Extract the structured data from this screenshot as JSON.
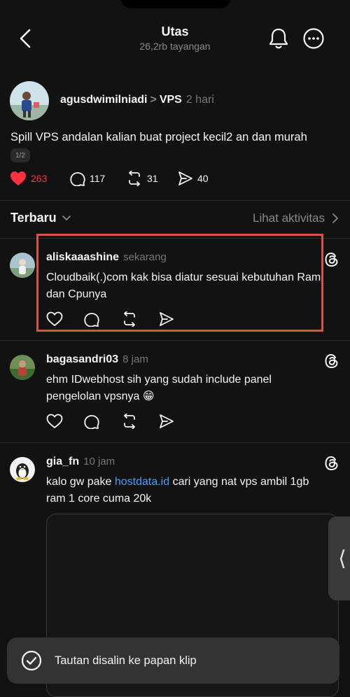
{
  "header": {
    "title": "Utas",
    "views": "26,2rb tayangan",
    "back_icon": "chevron-left-icon",
    "bell_icon": "bell-icon",
    "more_icon": "ellipsis-circle-icon"
  },
  "post": {
    "username": "agusdwimilniadi",
    "separator": ">",
    "topic": "VPS",
    "time": "2 hari",
    "text": "Spill VPS andalan kalian buat project kecil2 an dan murah",
    "page_indicator": "1/2",
    "likes": "263",
    "replies": "117",
    "reposts": "31",
    "shares": "40",
    "liked": true,
    "like_color": "#ff3040"
  },
  "sort": {
    "label": "Terbaru",
    "activity_label": "Lihat aktivitas"
  },
  "replies": [
    {
      "username": "aliskaaashine",
      "time": "sekarang",
      "text": "Cloudbaik(.)com kak bisa diatur sesuai kebutuhan Ram dan Cpunya",
      "highlighted": true
    },
    {
      "username": "bagasandri03",
      "time": "8 jam",
      "text": "ehm IDwebhost sih yang sudah include panel pengelolan vpsnya 😁"
    },
    {
      "username": "gia_fn",
      "time": "10 jam",
      "text_before": "kalo gw pake ",
      "link": "hostdata.id",
      "text_after": " cari yang nat vps ambil 1gb ram 1 core cuma 20k"
    }
  ],
  "toast": {
    "message": "Tautan disalin ke papan klip",
    "icon": "check-circle-icon"
  },
  "side_tab": {
    "glyph": "⟨"
  },
  "colors": {
    "background": "#121212",
    "link": "#4a9df8",
    "highlight_border": "#d9543e"
  }
}
